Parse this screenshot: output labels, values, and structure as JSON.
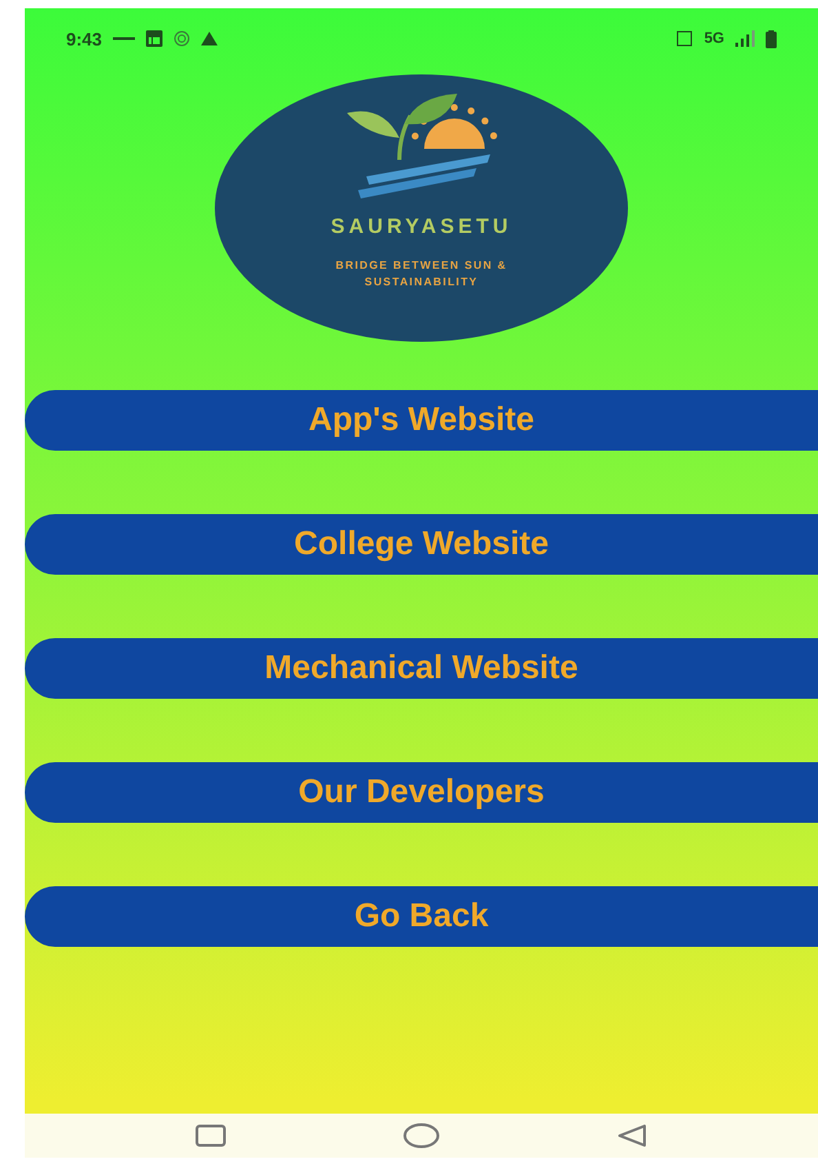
{
  "status_bar": {
    "time": "9:43",
    "network": "5G"
  },
  "logo": {
    "title": "SAURYASETU",
    "tagline": "BRIDGE BETWEEN SUN & SUSTAINABILITY"
  },
  "buttons": [
    {
      "label": "App's Website"
    },
    {
      "label": "College Website"
    },
    {
      "label": "Mechanical Website"
    },
    {
      "label": "Our Developers"
    },
    {
      "label": "Go Back"
    }
  ]
}
